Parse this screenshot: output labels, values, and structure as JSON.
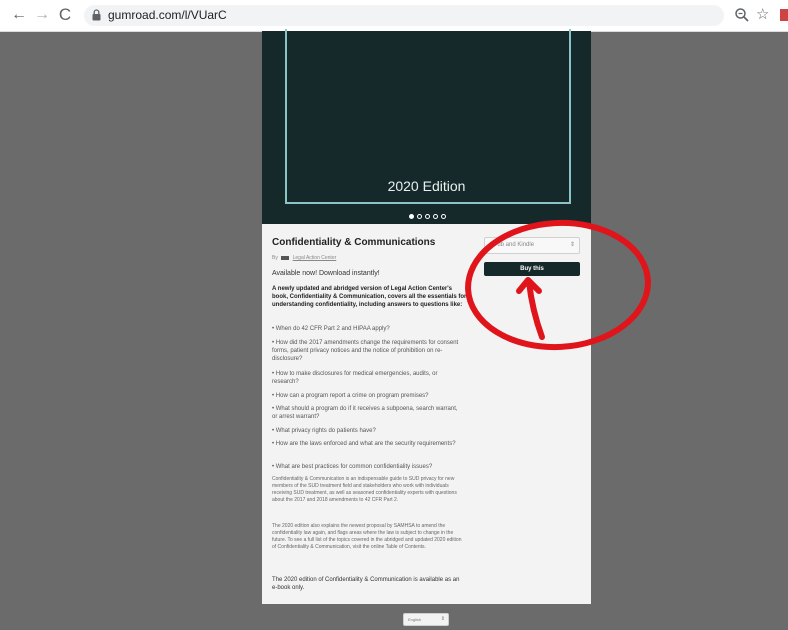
{
  "browser": {
    "back_icon": "←",
    "forward_icon": "→",
    "reload_icon": "C",
    "url": "gumroad.com/l/VUarC"
  },
  "cover": {
    "edition": "2020 Edition",
    "carousel_pages": 5,
    "carousel_active": 1
  },
  "product": {
    "title": "Confidentiality & Communications",
    "by_label": "By",
    "author": "Legal Action Center",
    "available": "Available now! Download instantly!",
    "description": "A newly updated and abridged version of Legal Action Center's book, Confidentiality & Communication, covers all the essentials for understanding confidentiality, including answers to questions like:",
    "questions": [
      "• When do 42 CFR Part 2 and HIPAA apply?",
      "• How did the 2017 amendments change the requirements for consent forms, patient privacy notices and the notice of prohibition on re-disclosure?",
      "• How to make disclosures for medical emergencies, audits, or research?",
      "• How can a program report a crime on program premises?",
      "• What should a program do if it receives a subpoena, search warrant, or arrest warrant?",
      "• What privacy rights do patients have?",
      "• How are the laws enforced and what are the security requirements?",
      "• What are best practices for common confidentiality issues?"
    ],
    "paragraph1": "Confidentiality & Communication is an indispensable guide to SUD privacy for new members of the SUD treatment field and stakeholders who work with individuals receiving SUD treatment, as well as seasoned confidentiality experts with questions about the 2017 and 2018 amendments to 42 CFR Part 2.",
    "paragraph2": "The 2020 edition also explains the newest proposal by SAMHSA to amend the confidentiality law again, and flags areas where the law is subject to change in the future. To see a full list of the topics covered in the abridged and updated 2020 edition of Confidentiality & Communication, visit the online Table of Contents.",
    "availability_note": "The 2020 edition of Confidentiality & Communication is available as an e-book only."
  },
  "purchase": {
    "format_selected": "ePub and Kindle",
    "buy_label": "Buy this"
  },
  "footer": {
    "language": "English"
  },
  "colors": {
    "cover_bg": "#16292a",
    "annotation": "#e0141b",
    "page_bg": "#6b6b6b"
  }
}
